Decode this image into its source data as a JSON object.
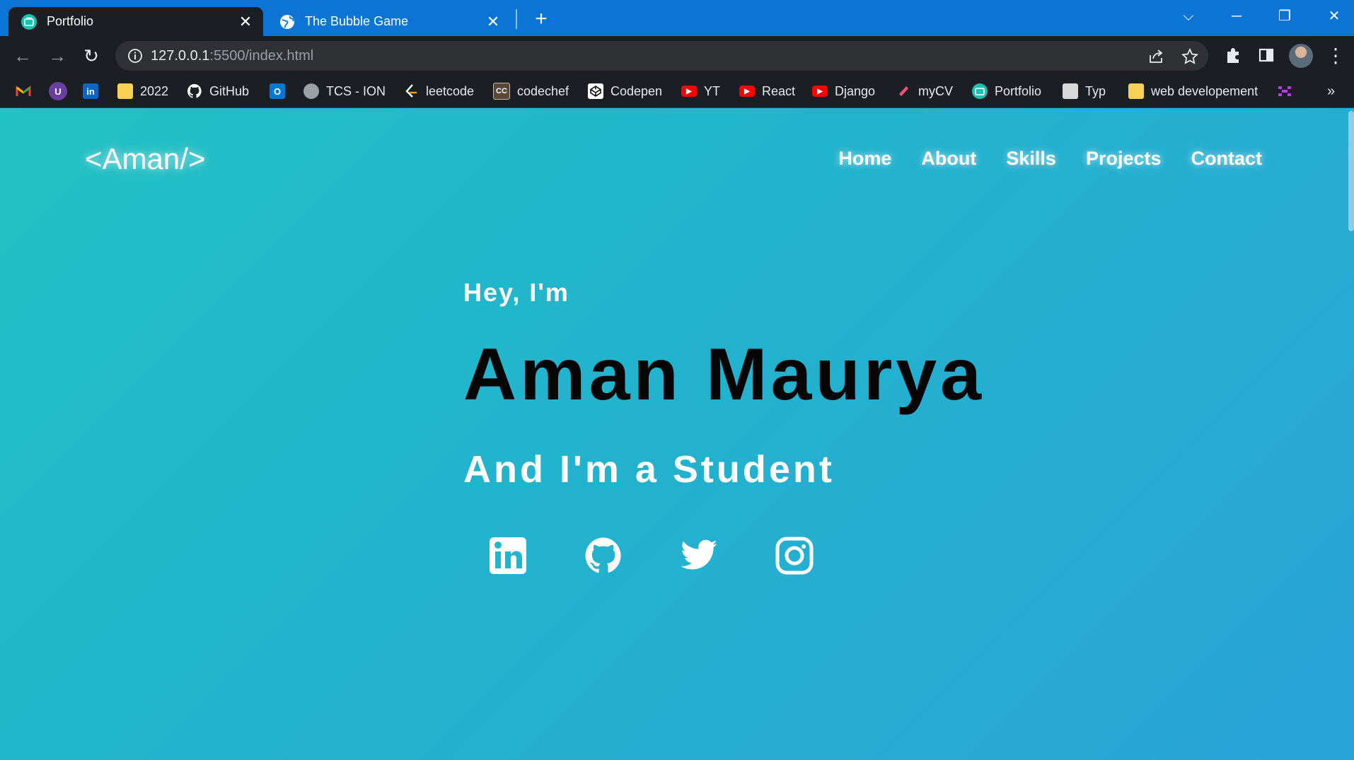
{
  "browser": {
    "tabs": [
      {
        "title": "Portfolio",
        "active": true,
        "icon": "portfolio-favicon"
      },
      {
        "title": "The Bubble Game",
        "active": false,
        "icon": "globe-icon"
      }
    ],
    "close_glyph": "✕",
    "new_tab_glyph": "+",
    "window_controls": {
      "tab_search": "⌵",
      "minimize": "─",
      "restore": "❐",
      "close": "✕"
    },
    "nav": {
      "back": "←",
      "forward": "→",
      "reload": "↻"
    },
    "address": {
      "host": "127.0.0.1",
      "path": ":5500/index.html"
    },
    "menu_glyph": "⋮",
    "bookmarks": [
      {
        "label": "",
        "icon": "gmail-icon"
      },
      {
        "label": "",
        "icon": "u-extension-icon"
      },
      {
        "label": "",
        "icon": "linkedin-icon"
      },
      {
        "label": "2022",
        "icon": "folder-icon"
      },
      {
        "label": "GitHub",
        "icon": "github-icon"
      },
      {
        "label": "",
        "icon": "outlook-icon"
      },
      {
        "label": "TCS - ION",
        "icon": "globe-icon"
      },
      {
        "label": "leetcode",
        "icon": "leetcode-icon"
      },
      {
        "label": "codechef",
        "icon": "codechef-icon"
      },
      {
        "label": "Codepen",
        "icon": "codepen-icon"
      },
      {
        "label": "YT",
        "icon": "youtube-icon"
      },
      {
        "label": "React",
        "icon": "youtube-icon"
      },
      {
        "label": "Django",
        "icon": "youtube-icon"
      },
      {
        "label": "myCV",
        "icon": "mycv-icon"
      },
      {
        "label": "Portfolio",
        "icon": "portfolio-favicon"
      },
      {
        "label": "Typ",
        "icon": "typing-icon"
      },
      {
        "label": "web developement",
        "icon": "folder-icon"
      },
      {
        "label": "",
        "icon": "extension-icon"
      }
    ],
    "bookmarks_overflow": "»",
    "colors": {
      "tabstrip": "#0b74d5",
      "toolbar": "#1b1f24",
      "omnibox": "#303134"
    }
  },
  "page": {
    "logo": "<Aman/>",
    "nav": [
      "Home",
      "About",
      "Skills",
      "Projects",
      "Contact"
    ],
    "hero": {
      "greeting": "Hey, I'm",
      "name": "Aman Maurya",
      "role": "And I'm a Student"
    },
    "socials": [
      "linkedin-icon",
      "github-icon",
      "twitter-icon",
      "instagram-icon"
    ],
    "colors": {
      "gradient_start": "#22c1c3",
      "gradient_end": "#2aa4d8",
      "name_text": "#050505"
    }
  }
}
